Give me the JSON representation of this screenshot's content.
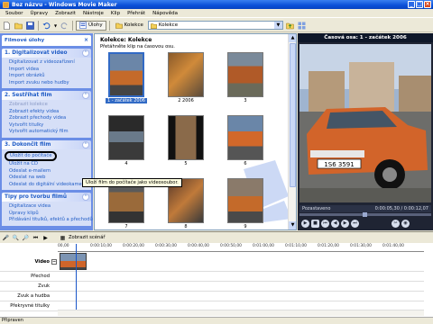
{
  "window": {
    "title": "Bez názvu - Windows Movie Maker"
  },
  "menu": [
    "Soubor",
    "Úpravy",
    "Zobrazit",
    "Nástroje",
    "Klip",
    "Přehrát",
    "Nápověda"
  ],
  "toolbar": {
    "tasks_label": "Úlohy",
    "collections_label": "Kolekce",
    "collection_select": "Kolekce"
  },
  "task_pane": {
    "title": "Filmové úlohy",
    "sections": [
      {
        "title": "1. Digitalizovat video",
        "links": [
          "Digitalizovat z videozařízení",
          "Import videa",
          "Import obrázků",
          "Import zvuku nebo hudby"
        ]
      },
      {
        "title": "2. Sestříhat film",
        "links": [
          "Zobrazit kolekce",
          "Zobrazit efekty videa",
          "Zobrazit přechody videa",
          "Vytvořit titulky",
          "Vytvořit automatický film"
        ]
      },
      {
        "title": "3. Dokončit film",
        "links": [
          "Uložit do počítače",
          "Uložit na CD",
          "Odeslat e-mailem",
          "Odeslat na web",
          "Odeslat do digitální videokamery"
        ]
      },
      {
        "title": "Tipy pro tvorbu filmů",
        "links": [
          "Digitalizace videa",
          "Úpravy klipů",
          "Přidávání titulků, efektů a přechodů"
        ]
      }
    ]
  },
  "tooltip": "Uloží film do počítače jako videosoubor.",
  "collection": {
    "title": "Kolekce: Kolekce",
    "subtitle": "Přetáhněte klip na časovou osu.",
    "items": [
      "1 - začátek 2006",
      "2 2006",
      "3",
      "4",
      "5",
      "6",
      "7",
      "8",
      "9"
    ]
  },
  "monitor": {
    "title": "Časová osa: 1 - začátek 2006",
    "status_left": "Pozastaveno",
    "status_right": "0:00:05,30 / 0:00:12,07",
    "plate": "1S6 3591"
  },
  "timeline": {
    "storyboard_label": "Zobrazit scénář",
    "ticks": [
      "00,00",
      "0:00:10,00",
      "0:00:20,00",
      "0:00:30,00",
      "0:00:40,00",
      "0:00:50,00",
      "0:01:00,00",
      "0:01:10,00",
      "0:01:20,00",
      "0:01:30,00",
      "0:01:40,00"
    ],
    "tracks": [
      "Video",
      "Přechod",
      "Zvuk",
      "Zvuk a hudba",
      "Překryvné titulky"
    ]
  },
  "statusbar": "Připraven"
}
